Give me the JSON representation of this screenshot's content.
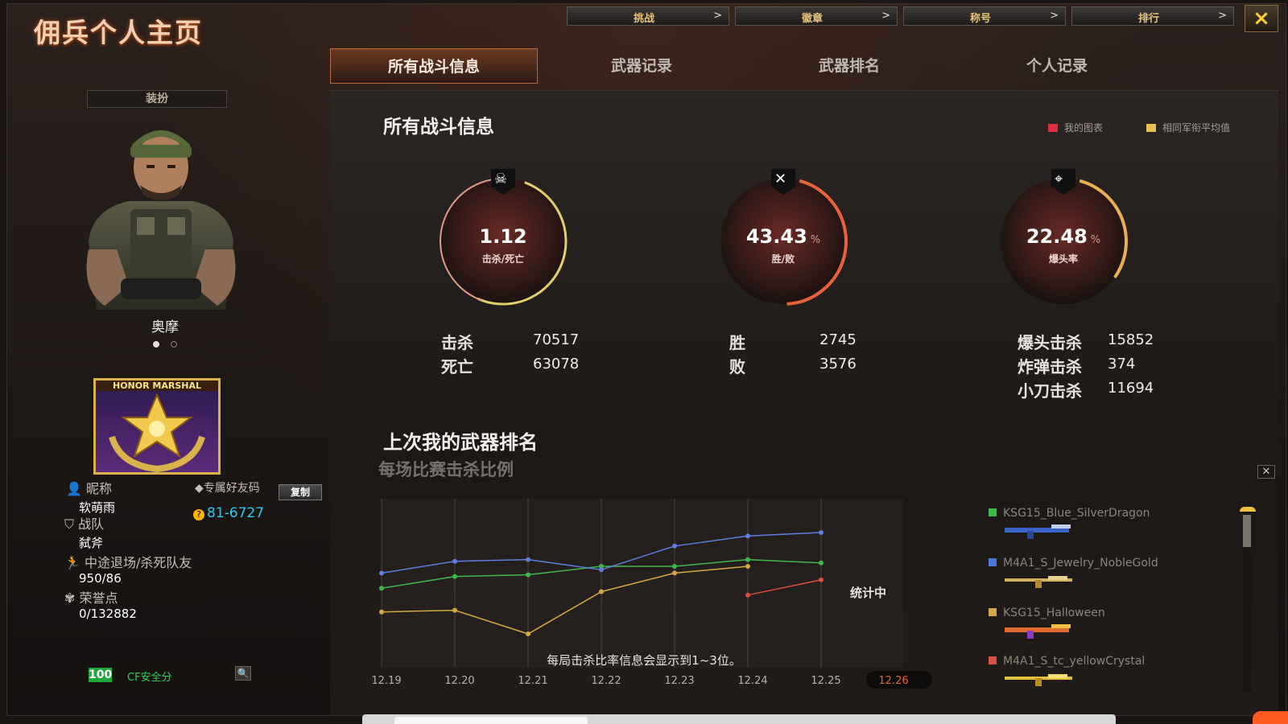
{
  "window": {
    "title": "佣兵个人主页",
    "close_icon": "×"
  },
  "top_nav": [
    {
      "label": "挑战",
      "arrow": ">"
    },
    {
      "label": "徽章",
      "arrow": ">"
    },
    {
      "label": "称号",
      "arrow": ">"
    },
    {
      "label": "排行",
      "arrow": ">"
    }
  ],
  "tabs": [
    {
      "label": "所有战斗信息",
      "active": true
    },
    {
      "label": "武器记录",
      "active": false
    },
    {
      "label": "武器排名",
      "active": false
    },
    {
      "label": "个人记录",
      "active": false
    }
  ],
  "profile": {
    "outfit_label": "装扮",
    "character_name": "奥摩",
    "badge_text": "HONOR MARSHAL",
    "nickname_label": "昵称",
    "nickname": "软萌雨",
    "friend_code_label": "专属好友码",
    "copy_button": "复制",
    "friend_code": "81-6727",
    "team_label": "战队",
    "team": "弑斧",
    "quit_label": "中途退场/杀死队友",
    "quit_value": "950/86",
    "honor_label": "荣誉点",
    "honor_value": "0/132882",
    "security_score": "100",
    "security_label": "CF安全分"
  },
  "stats": {
    "title": "所有战斗信息",
    "legend": [
      {
        "label": "我的图表",
        "color": "#e03040"
      },
      {
        "label": "相同军衔平均值",
        "color": "#e8c050"
      }
    ],
    "gauges": [
      {
        "value": "1.12",
        "unit": "",
        "sub": "击杀/死亡",
        "icon": "skull-icon"
      },
      {
        "value": "43.43",
        "unit": "%",
        "sub": "胜/败",
        "icon": "crossed-guns-icon"
      },
      {
        "value": "22.48",
        "unit": "%",
        "sub": "爆头率",
        "icon": "headshot-icon"
      }
    ],
    "rows": {
      "kills_label": "击杀",
      "kills": "70517",
      "deaths_label": "死亡",
      "deaths": "63078",
      "wins_label": "胜",
      "wins": "2745",
      "losses_label": "败",
      "losses": "3576",
      "headshot_label": "爆头击杀",
      "headshot": "15852",
      "bomb_label": "炸弹击杀",
      "bomb": "374",
      "knife_label": "小刀击杀",
      "knife": "11694"
    }
  },
  "ranking": {
    "title": "上次我的武器排名",
    "subtitle": "每场比赛击杀比例",
    "status": "统计中",
    "note": "每局击杀比率信息会显示到1~3位。",
    "weapons": [
      {
        "name": "KSG15_Blue_SilverDragon",
        "color": "#3fb84a"
      },
      {
        "name": "M4A1_S_Jewelry_NobleGold",
        "color": "#4a78d8"
      },
      {
        "name": "KSG15_Halloween",
        "color": "#d8a840"
      },
      {
        "name": "M4A1_S_tc_yellowCrystal",
        "color": "#d85040"
      }
    ]
  },
  "chart_data": {
    "type": "line",
    "x": [
      "12.19",
      "12.20",
      "12.21",
      "12.22",
      "12.23",
      "12.24",
      "12.25",
      "12.26"
    ],
    "highlight_x": "12.26",
    "series": [
      {
        "name": "KSG15_Blue_SilverDragon",
        "color": "#3fb84a",
        "values": [
          0.47,
          0.54,
          0.55,
          0.6,
          0.6,
          0.64,
          0.62,
          null
        ]
      },
      {
        "name": "M4A1_S_Jewelry_NobleGold",
        "color": "#5a7fe0",
        "values": [
          0.56,
          0.63,
          0.64,
          0.58,
          0.72,
          0.78,
          0.8,
          null
        ]
      },
      {
        "name": "KSG15_Halloween",
        "color": "#d8a840",
        "values": [
          0.33,
          0.34,
          0.2,
          0.45,
          0.56,
          0.6,
          null,
          null
        ]
      },
      {
        "name": "M4A1_S_tc_yellowCrystal",
        "color": "#d85040",
        "values": [
          null,
          null,
          null,
          null,
          null,
          0.43,
          0.52,
          null
        ]
      }
    ],
    "ylim": [
      0,
      1
    ]
  }
}
